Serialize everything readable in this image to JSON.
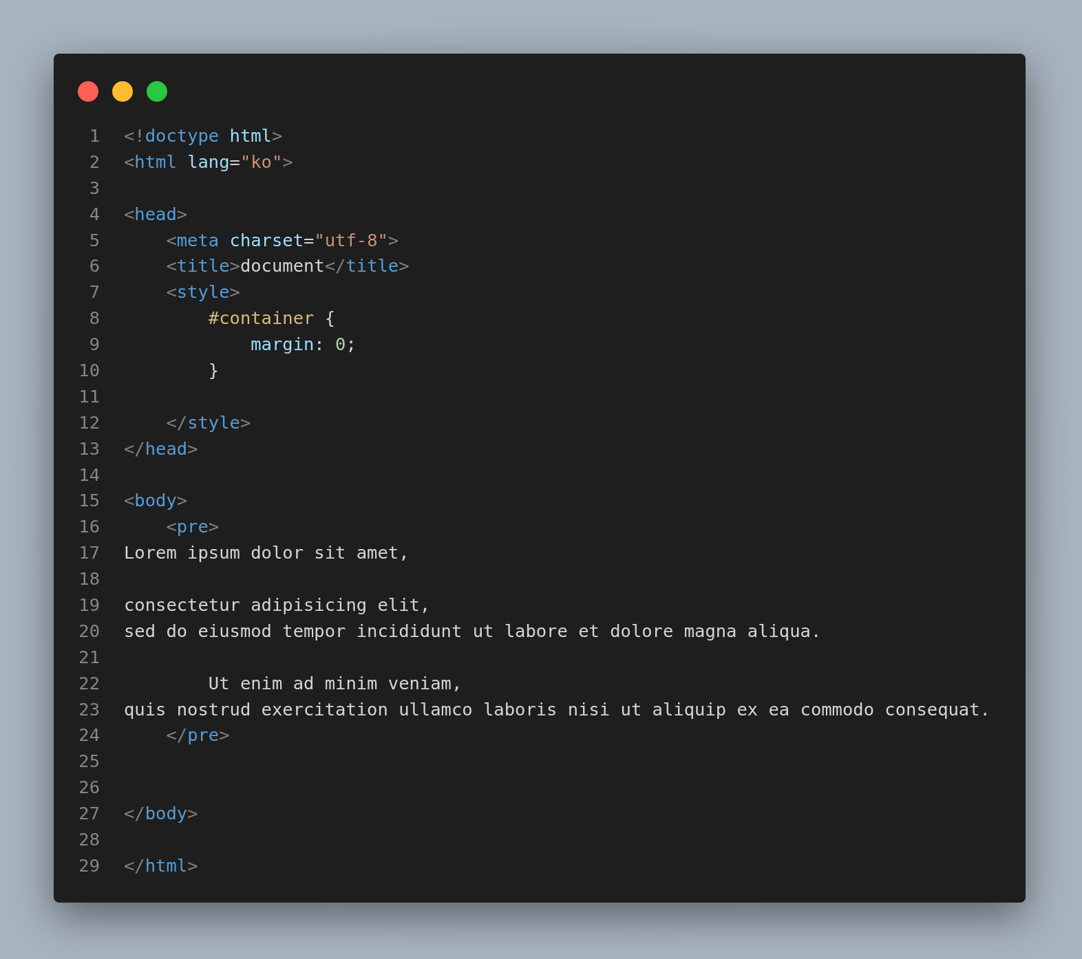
{
  "lines": [
    {
      "number": "1",
      "tokens": [
        {
          "kind": "punct",
          "text": "<!"
        },
        {
          "kind": "tag",
          "text": "doctype"
        },
        {
          "kind": "attr",
          "text": " html"
        },
        {
          "kind": "punct",
          "text": ">"
        }
      ]
    },
    {
      "number": "2",
      "tokens": [
        {
          "kind": "punct",
          "text": "<"
        },
        {
          "kind": "tag",
          "text": "html"
        },
        {
          "kind": "attr",
          "text": " lang"
        },
        {
          "kind": "text",
          "text": "="
        },
        {
          "kind": "string",
          "text": "\"ko\""
        },
        {
          "kind": "punct",
          "text": ">"
        }
      ]
    },
    {
      "number": "3"
    },
    {
      "number": "4",
      "tokens": [
        {
          "kind": "punct",
          "text": "<"
        },
        {
          "kind": "tag",
          "text": "head"
        },
        {
          "kind": "punct",
          "text": ">"
        }
      ]
    },
    {
      "number": "5",
      "tokens": [
        {
          "kind": "punct",
          "text": "    <"
        },
        {
          "kind": "tag",
          "text": "meta"
        },
        {
          "kind": "attr",
          "text": " charset"
        },
        {
          "kind": "text",
          "text": "="
        },
        {
          "kind": "string",
          "text": "\"utf-8\""
        },
        {
          "kind": "punct",
          "text": ">"
        }
      ]
    },
    {
      "number": "6",
      "tokens": [
        {
          "kind": "punct",
          "text": "    <"
        },
        {
          "kind": "tag",
          "text": "title"
        },
        {
          "kind": "punct",
          "text": ">"
        },
        {
          "kind": "text",
          "text": "document"
        },
        {
          "kind": "punct",
          "text": "</"
        },
        {
          "kind": "tag",
          "text": "title"
        },
        {
          "kind": "punct",
          "text": ">"
        }
      ]
    },
    {
      "number": "7",
      "tokens": [
        {
          "kind": "punct",
          "text": "    <"
        },
        {
          "kind": "tag",
          "text": "style"
        },
        {
          "kind": "punct",
          "text": ">"
        }
      ]
    },
    {
      "number": "8",
      "tokens": [
        {
          "kind": "selector",
          "text": "        #container"
        },
        {
          "kind": "text",
          "text": " {"
        }
      ]
    },
    {
      "number": "9",
      "tokens": [
        {
          "kind": "attr",
          "text": "            margin"
        },
        {
          "kind": "text",
          "text": ": "
        },
        {
          "kind": "number",
          "text": "0"
        },
        {
          "kind": "text",
          "text": ";"
        }
      ]
    },
    {
      "number": "10",
      "tokens": [
        {
          "kind": "text",
          "text": "        }"
        }
      ]
    },
    {
      "number": "11"
    },
    {
      "number": "12",
      "tokens": [
        {
          "kind": "punct",
          "text": "    </"
        },
        {
          "kind": "tag",
          "text": "style"
        },
        {
          "kind": "punct",
          "text": ">"
        }
      ]
    },
    {
      "number": "13",
      "tokens": [
        {
          "kind": "punct",
          "text": "</"
        },
        {
          "kind": "tag",
          "text": "head"
        },
        {
          "kind": "punct",
          "text": ">"
        }
      ]
    },
    {
      "number": "14"
    },
    {
      "number": "15",
      "tokens": [
        {
          "kind": "punct",
          "text": "<"
        },
        {
          "kind": "tag",
          "text": "body"
        },
        {
          "kind": "punct",
          "text": ">"
        }
      ]
    },
    {
      "number": "16",
      "tokens": [
        {
          "kind": "punct",
          "text": "    <"
        },
        {
          "kind": "tag",
          "text": "pre"
        },
        {
          "kind": "punct",
          "text": ">"
        }
      ]
    },
    {
      "number": "17",
      "tokens": [
        {
          "kind": "text",
          "text": "Lorem ipsum dolor sit amet,"
        }
      ]
    },
    {
      "number": "18"
    },
    {
      "number": "19",
      "tokens": [
        {
          "kind": "text",
          "text": "consectetur adipisicing elit,"
        }
      ]
    },
    {
      "number": "20",
      "tokens": [
        {
          "kind": "text",
          "text": "sed do eiusmod tempor incididunt ut labore et dolore magna aliqua."
        }
      ]
    },
    {
      "number": "21"
    },
    {
      "number": "22",
      "tokens": [
        {
          "kind": "text",
          "text": "        Ut enim ad minim veniam,"
        }
      ]
    },
    {
      "number": "23",
      "tokens": [
        {
          "kind": "text",
          "text": "quis nostrud exercitation ullamco laboris nisi ut aliquip ex ea commodo consequat."
        }
      ]
    },
    {
      "number": "24",
      "tokens": [
        {
          "kind": "punct",
          "text": "    </"
        },
        {
          "kind": "tag",
          "text": "pre"
        },
        {
          "kind": "punct",
          "text": ">"
        }
      ]
    },
    {
      "number": "25"
    },
    {
      "number": "26"
    },
    {
      "number": "27",
      "tokens": [
        {
          "kind": "punct",
          "text": "</"
        },
        {
          "kind": "tag",
          "text": "body"
        },
        {
          "kind": "punct",
          "text": ">"
        }
      ]
    },
    {
      "number": "28"
    },
    {
      "number": "29",
      "tokens": [
        {
          "kind": "punct",
          "text": "</"
        },
        {
          "kind": "tag",
          "text": "html"
        },
        {
          "kind": "punct",
          "text": ">"
        }
      ]
    }
  ]
}
